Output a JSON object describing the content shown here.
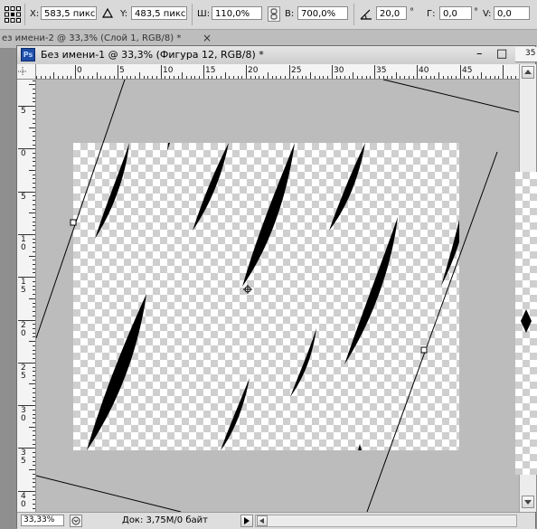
{
  "options_bar": {
    "x_label": "X:",
    "x_value": "583,5 пикс.",
    "y_label": "Y:",
    "y_value": "483,5 пикс.",
    "w_label": "Ш:",
    "w_value": "110,0%",
    "h_label": "В:",
    "h_value": "700,0%",
    "angle_value": "20,0",
    "angle_unit": "°",
    "hskew_label": "Г:",
    "hskew_value": "0,0",
    "vskew_label": "V:",
    "vskew_value": "0,0",
    "deg_mark": "°"
  },
  "background_tab": {
    "title": "ез имени-2 @ 33,3% (Слой 1, RGB/8) *",
    "close": "×"
  },
  "document": {
    "app_badge": "Ps",
    "title": "Без имени-1 @ 33,3% (Фигура 12, RGB/8) *",
    "minimize": "–",
    "maximize": "□",
    "close": "×"
  },
  "ruler_h_labels": [
    "0",
    "5",
    "10",
    "15",
    "20",
    "25",
    "30",
    "35",
    "40",
    "45"
  ],
  "ruler_v_labels": [
    "5",
    "0",
    "5",
    "1\n0",
    "1\n5",
    "2\n0",
    "2\n5",
    "3\n0",
    "3\n5",
    "4\n0"
  ],
  "right_ruler_label": "35",
  "status": {
    "zoom": "33,33%",
    "doc_info": "Док: 3,75M/0 байт"
  },
  "colors": {
    "shape_fill": "#000000",
    "canvas_bg": "#bcbcbc",
    "titlebar": "#d4d4d4"
  },
  "icons": [
    "reference-point-icon",
    "delta-icon",
    "link-icon",
    "angle-icon",
    "ps-logo-icon",
    "status-menu-icon"
  ]
}
